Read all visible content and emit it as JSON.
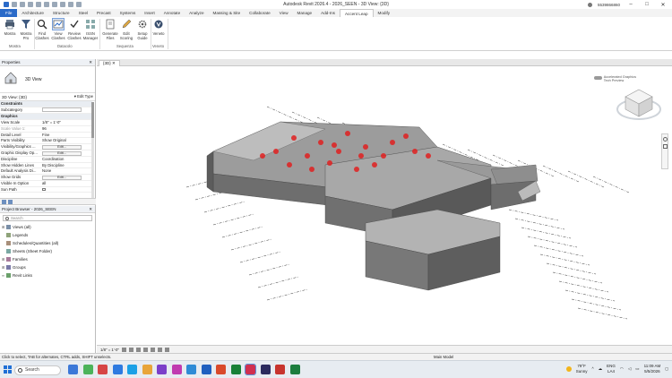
{
  "window": {
    "title": "Autodesk Revit 2026.4 - 2026_SEEN - 3D View: {3D}",
    "user": "5539866860"
  },
  "tabs": [
    "File",
    "Architecture",
    "Structure",
    "Steel",
    "Precast",
    "Systems",
    "Insert",
    "Annotate",
    "Analyze",
    "Massing & Site",
    "Collaborate",
    "View",
    "Manage",
    "Add-Ins",
    "Accent Leap",
    "Modify"
  ],
  "active_tab": "Accent Leap",
  "ribbon": {
    "buttons": [
      {
        "label": "Mostra",
        "sub": ""
      },
      {
        "label": "Mostra",
        "sub": "Pro"
      },
      {
        "label": "Find",
        "sub": "Clashes"
      },
      {
        "label": "View",
        "sub": "Clashes"
      },
      {
        "label": "Review",
        "sub": "Clashes"
      },
      {
        "label": "ISSN",
        "sub": "Manager"
      },
      {
        "label": "Generate",
        "sub": "Files"
      },
      {
        "label": "Edit",
        "sub": "Scoring"
      },
      {
        "label": "Setup",
        "sub": "Guide"
      },
      {
        "label": "Veneto",
        "sub": ""
      }
    ],
    "groups": [
      "Mostra",
      "Datacolo",
      "Sequenza",
      "Veneto"
    ]
  },
  "properties": {
    "header": "Properties",
    "type_name": "3D View",
    "view_selector": "3D View: {3D}",
    "edit_type": "Edit Type",
    "rows": [
      {
        "k": "Constraints",
        "v": "",
        "section": true
      },
      {
        "k": "Subcategory",
        "v": "",
        "input": true
      },
      {
        "k": "Graphics",
        "v": "",
        "section": true
      },
      {
        "k": "View Scale",
        "v": "1/8\" = 1'-0\""
      },
      {
        "k": "Scale Value 1:",
        "v": "96",
        "dim": true
      },
      {
        "k": "Detail Level",
        "v": "Fine"
      },
      {
        "k": "Parts Visibility",
        "v": "Show Original"
      },
      {
        "k": "Visibility/Graphics ...",
        "v": "Edit...",
        "button": true
      },
      {
        "k": "Graphic Display Op...",
        "v": "Edit...",
        "button": true
      },
      {
        "k": "Discipline",
        "v": "Coordination"
      },
      {
        "k": "Show Hidden Lines",
        "v": "By Discipline"
      },
      {
        "k": "Default Analysis Di...",
        "v": "None"
      },
      {
        "k": "Show Grids",
        "v": "Edit...",
        "button": true
      },
      {
        "k": "Visible In Option",
        "v": "all"
      },
      {
        "k": "Sun Path",
        "v": "",
        "check": true
      }
    ]
  },
  "browser": {
    "header": "Project Browser - 2026_SEEN",
    "search_placeholder": "Search",
    "items": [
      {
        "label": "Views (all)",
        "toggle": "⊞"
      },
      {
        "label": "Legends",
        "toggle": ""
      },
      {
        "label": "Schedules/Quantities (all)",
        "toggle": ""
      },
      {
        "label": "Sheets (Sheet Folder)",
        "toggle": ""
      },
      {
        "label": "Families",
        "toggle": "⊞"
      },
      {
        "label": "Groups",
        "toggle": "⊞"
      },
      {
        "label": "Revit Links",
        "toggle": "∞"
      }
    ]
  },
  "view_tab": "{3D}",
  "viewcube": {
    "label_top": "Accelerated Graphics",
    "label_bottom": "Tech Preview"
  },
  "view_control": {
    "scale": "1/8\" = 1'-0\""
  },
  "status": {
    "hint": "Click to select, TAB for alternates, CTRL adds, SHIFT unselects.",
    "model": "Main Model"
  },
  "taskbar": {
    "search": "Search",
    "weather_temp": "79°F",
    "weather_desc": "Sunny",
    "lang1": "ENG",
    "lang2": "LA4",
    "time": "11:09 AM",
    "date": "5/5/2026"
  },
  "colors": {
    "accent": "#2a6ac8",
    "clash": "#e02020",
    "model_gray": "#8d8d8d"
  }
}
